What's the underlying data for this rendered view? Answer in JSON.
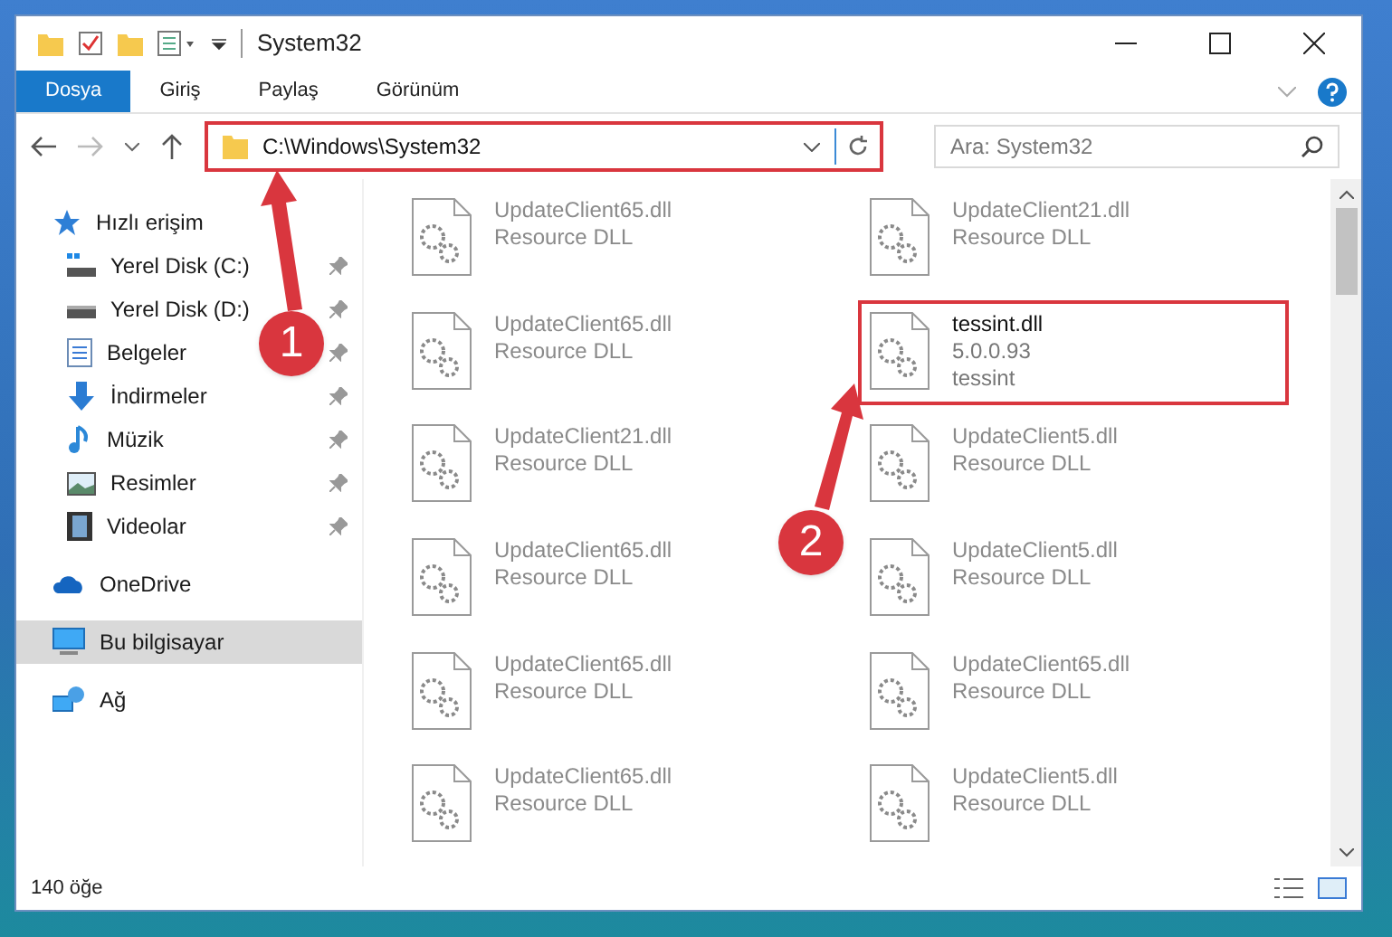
{
  "window": {
    "title": "System32"
  },
  "ribbon_tabs": [
    {
      "label": "Dosya",
      "selected": true
    },
    {
      "label": "Giriş",
      "selected": false
    },
    {
      "label": "Paylaş",
      "selected": false
    },
    {
      "label": "Görünüm",
      "selected": false
    }
  ],
  "address_bar": {
    "value": "C:\\Windows\\System32",
    "highlighted": true
  },
  "search": {
    "placeholder": "Ara: System32"
  },
  "sidebar": {
    "items": [
      {
        "label": "Hızlı erişim",
        "selected": false,
        "children": [
          {
            "label": "Yerel Disk (C:)",
            "pinned": true,
            "selected": false
          },
          {
            "label": "Yerel Disk (D:)",
            "pinned": true,
            "selected": false
          },
          {
            "label": "Belgeler",
            "pinned": true,
            "selected": false
          },
          {
            "label": "İndirmeler",
            "pinned": true,
            "selected": false
          },
          {
            "label": "Müzik",
            "pinned": true,
            "selected": false
          },
          {
            "label": "Resimler",
            "pinned": true,
            "selected": false
          },
          {
            "label": "Videolar",
            "pinned": true,
            "selected": false
          }
        ]
      },
      {
        "label": "OneDrive",
        "selected": false
      },
      {
        "label": "Bu bilgisayar",
        "selected": true
      },
      {
        "label": "Ağ",
        "selected": false
      }
    ]
  },
  "files": [
    {
      "name": "UpdateClient65.dll",
      "line_2": "Resource DLL",
      "faded": true,
      "highlighted": false
    },
    {
      "name": "UpdateClient21.dll",
      "line_2": "Resource DLL",
      "faded": true,
      "highlighted": false
    },
    {
      "name": "UpdateClient65.dll",
      "line_2": "Resource DLL",
      "faded": true,
      "highlighted": false
    },
    {
      "name": "tessint.dll",
      "line_2": "5.0.0.93",
      "line_3": "tessint",
      "faded": false,
      "highlighted": true
    },
    {
      "name": "UpdateClient21.dll",
      "line_2": "Resource DLL",
      "faded": true,
      "highlighted": false
    },
    {
      "name": "UpdateClient5.dll",
      "line_2": "Resource DLL",
      "faded": true,
      "highlighted": false
    },
    {
      "name": "UpdateClient65.dll",
      "line_2": "Resource DLL",
      "faded": true,
      "highlighted": false
    },
    {
      "name": "UpdateClient5.dll",
      "line_2": "Resource DLL",
      "faded": true,
      "highlighted": false
    },
    {
      "name": "UpdateClient65.dll",
      "line_2": "Resource DLL",
      "faded": true,
      "highlighted": false
    },
    {
      "name": "UpdateClient65.dll",
      "line_2": "Resource DLL",
      "faded": true,
      "highlighted": false
    },
    {
      "name": "UpdateClient65.dll",
      "line_2": "Resource DLL",
      "faded": true,
      "highlighted": false
    },
    {
      "name": "UpdateClient5.dll",
      "line_2": "Resource DLL",
      "faded": true,
      "highlighted": false
    }
  ],
  "annotations": [
    {
      "number": "1"
    },
    {
      "number": "2"
    }
  ],
  "status_bar": {
    "count": "140 öğe"
  }
}
